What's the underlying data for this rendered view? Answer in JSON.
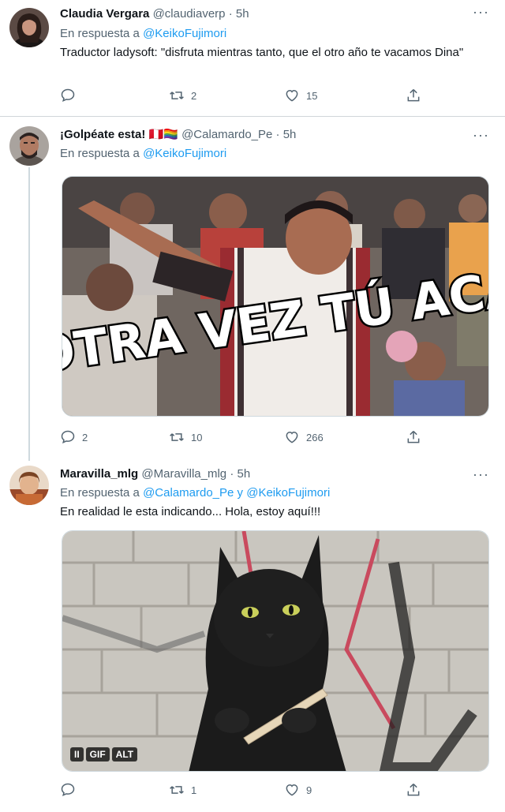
{
  "tweets": [
    {
      "name": "Claudia Vergara",
      "handle": "@claudiaverp",
      "dot": "·",
      "time": "5h",
      "reply_prefix": "En respuesta a",
      "reply_mentions": [
        "@KeikoFujimori"
      ],
      "text": "Traductor ladysoft: \"disfruta mientras tanto, que el otro año te vacamos Dina\"",
      "replies": "",
      "retweets": "2",
      "likes": "15"
    },
    {
      "name": "¡Golpéate esta!",
      "flags": "🇵🇪🏳️‍🌈",
      "handle": "@Calamardo_Pe",
      "dot": "·",
      "time": "5h",
      "reply_prefix": "En respuesta a",
      "reply_mentions": [
        "@KeikoFujimori"
      ],
      "gif_caption": "OTRA VEZ TÚ ACÁ",
      "replies": "2",
      "retweets": "10",
      "likes": "266"
    },
    {
      "name": "Maravilla_mlg",
      "handle": "@Maravilla_mlg",
      "dot": "·",
      "time": "5h",
      "reply_prefix": "En respuesta a",
      "reply_mentions": [
        "@Calamardo_Pe",
        "@KeikoFujimori"
      ],
      "reply_join": "y",
      "text": "En realidad le esta indicando... Hola, estoy aquí!!!",
      "media_badges": [
        "II",
        "GIF",
        "ALT"
      ],
      "replies": "",
      "retweets": "1",
      "likes": "9"
    }
  ],
  "colors": {
    "accent": "#1d9bf0",
    "secondary_text": "#536471",
    "divider": "#d0d6da"
  }
}
